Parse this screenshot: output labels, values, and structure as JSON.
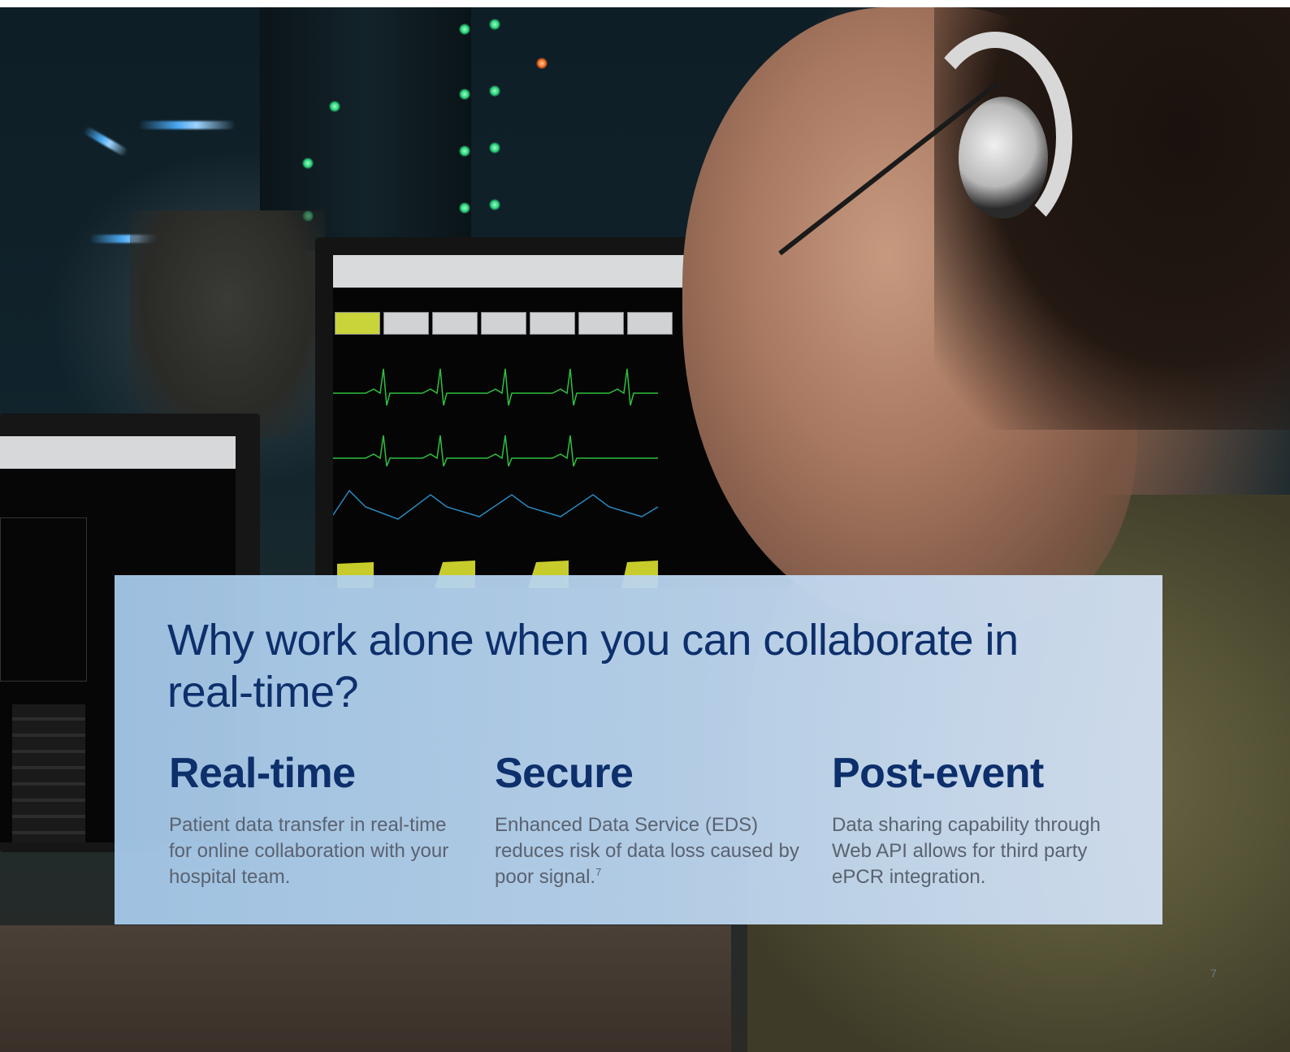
{
  "headline": "Why work alone when you can collaborate in real-time?",
  "features": [
    {
      "title": "Real-time",
      "description": "Patient data transfer in real-time for online collaboration with your hospital team."
    },
    {
      "title": "Secure",
      "description": "Enhanced Data Service (EDS) reduces risk of data loss caused by poor signal.",
      "footnote": "7"
    },
    {
      "title": "Post-event",
      "description": "Data sharing capability through Web API allows for third party ePCR integration."
    }
  ],
  "page_number": "7",
  "colors": {
    "heading": "#0d2f6b",
    "body_text": "#5a6270",
    "panel": "#b4d2ee"
  }
}
